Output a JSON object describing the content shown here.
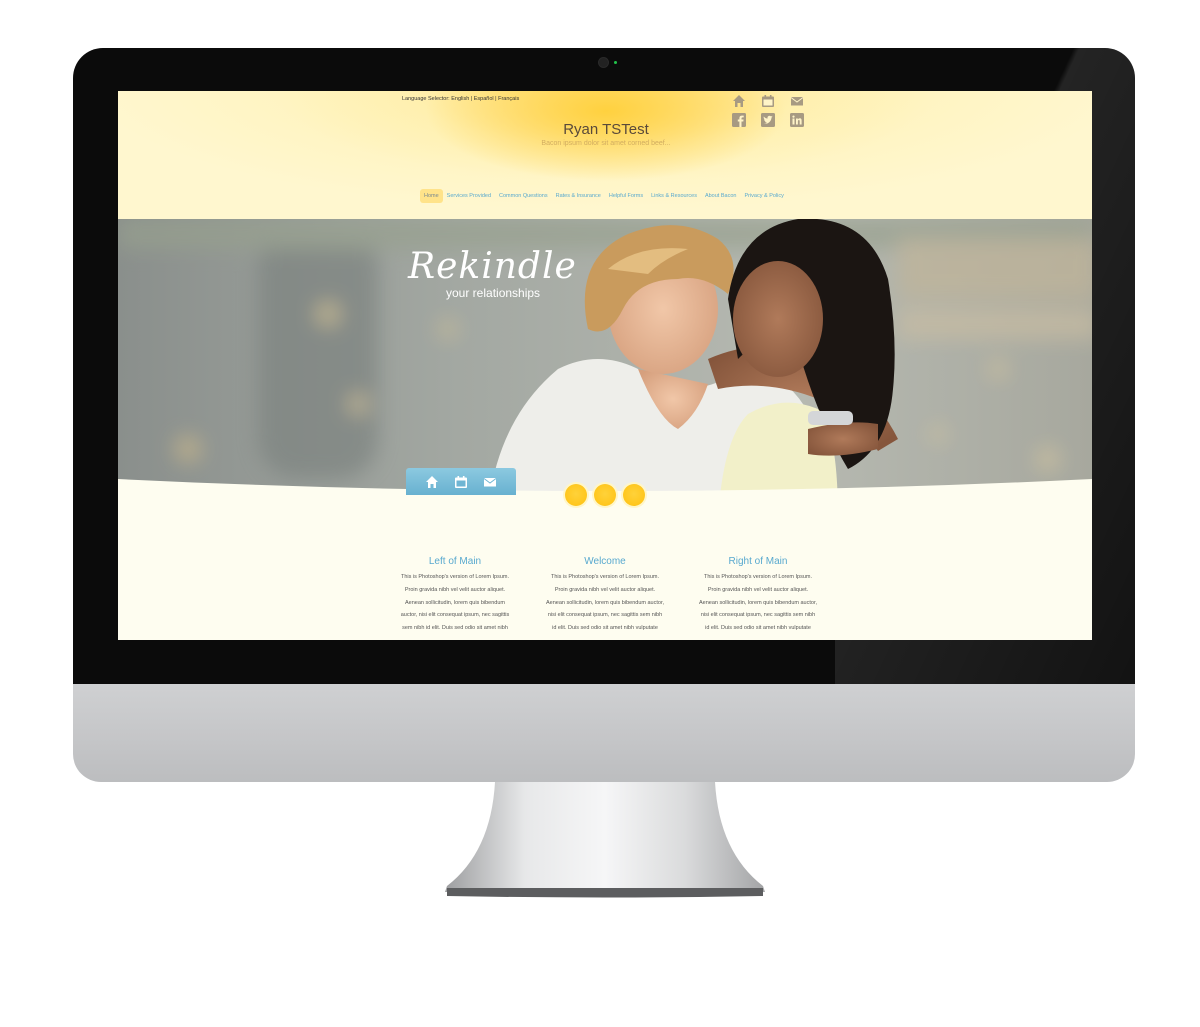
{
  "header": {
    "language_selector": "Language Selector: English | Español | Français",
    "site_title": "Ryan TSTest",
    "tagline": "Bacon ipsum dolor sit amet corned beef...",
    "icons": [
      "home-icon",
      "calendar-icon",
      "mail-icon",
      "facebook-icon",
      "twitter-icon",
      "linkedin-icon"
    ]
  },
  "nav": {
    "items": [
      {
        "label": "Home",
        "active": true
      },
      {
        "label": "Services Provided"
      },
      {
        "label": "Common Questions"
      },
      {
        "label": "Rates & Insurance"
      },
      {
        "label": "Helpful Forms"
      },
      {
        "label": "Links & Resources"
      },
      {
        "label": "About Bacon"
      },
      {
        "label": "Privacy & Policy"
      }
    ]
  },
  "hero": {
    "headline": "Rekindle",
    "subheadline": "your relationships",
    "quick_icons": [
      "home-icon",
      "calendar-icon",
      "mail-icon"
    ],
    "slides_count": 3
  },
  "columns": [
    {
      "title": "Left of Main",
      "lines": [
        "This is Photoshop's version  of Lorem Ipsum.",
        "Proin gravida nibh vel velit auctor aliquet.",
        "Aenean sollicitudin, lorem quis bibendum",
        "auctor, nisi elit consequat ipsum, nec sagittis",
        "sem nibh id elit. Duis sed odio sit amet nibh"
      ]
    },
    {
      "title": "Welcome",
      "lines": [
        "This is Photoshop's version  of Lorem Ipsum.",
        "Proin gravida nibh vel velit auctor aliquet.",
        "Aenean sollicitudin, lorem quis bibendum auctor,",
        "nisi elit consequat ipsum, nec sagittis sem nibh",
        "id elit. Duis sed odio sit amet nibh vulputate"
      ]
    },
    {
      "title": "Right of Main",
      "lines": [
        "This is Photoshop's version  of Lorem Ipsum.",
        "Proin gravida nibh vel velit auctor aliquet.",
        "Aenean sollicitudin, lorem quis bibendum auctor,",
        "nisi elit consequat ipsum, nec sagittis sem nibh",
        "id elit. Duis sed odio sit amet nibh vulputate"
      ]
    }
  ],
  "colors": {
    "accent_blue": "#58a9cf",
    "header_yellow": "#ffd13f",
    "page_cream": "#fefdf0",
    "dot_yellow": "#ffc61c"
  }
}
